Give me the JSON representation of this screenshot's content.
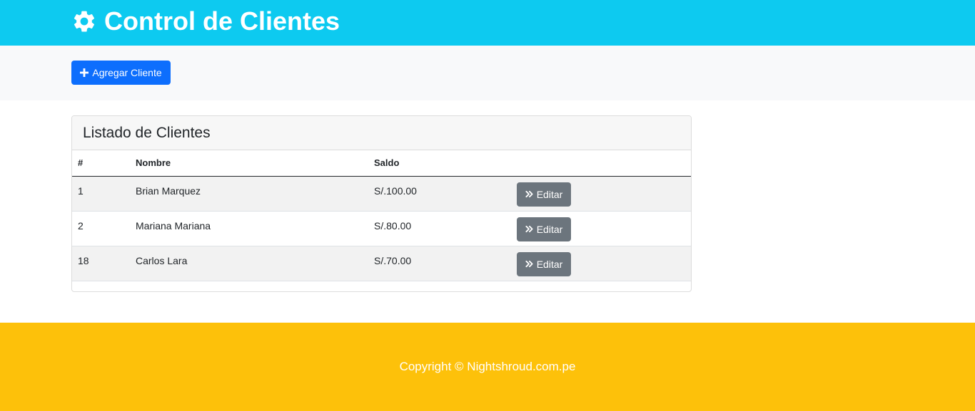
{
  "header": {
    "title": "Control de Clientes",
    "icon": "gear-icon"
  },
  "actions": {
    "add_label": "Agregar Cliente",
    "add_icon": "plus-icon"
  },
  "card": {
    "title": "Listado de Clientes"
  },
  "table": {
    "columns": [
      "#",
      "Nombre",
      "Saldo",
      ""
    ],
    "rows": [
      {
        "num": "1",
        "nombre": "Brian Marquez",
        "saldo": "S/.100.00",
        "action_label": "Editar"
      },
      {
        "num": "2",
        "nombre": "Mariana Mariana",
        "saldo": "S/.80.00",
        "action_label": "Editar"
      },
      {
        "num": "18",
        "nombre": "Carlos Lara",
        "saldo": "S/.70.00",
        "action_label": "Editar"
      }
    ]
  },
  "footer": {
    "text": "Copyright © Nightshroud.com.pe"
  },
  "colors": {
    "header_bg": "#0dcaf0",
    "primary": "#0d6efd",
    "secondary": "#6c757d",
    "footer_bg": "#fdc10a"
  }
}
